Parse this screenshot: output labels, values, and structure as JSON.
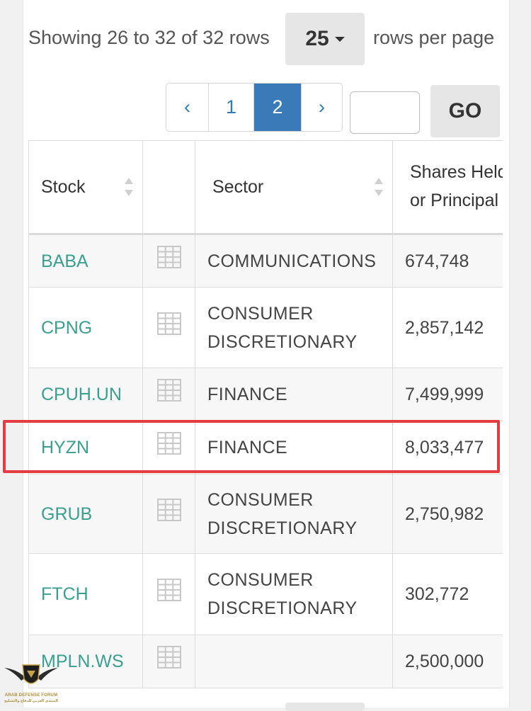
{
  "pagination": {
    "showing_text": "Showing 26 to 32 of 32 rows",
    "page_size": "25",
    "rows_per_page_text": "rows per page",
    "prev_label": "‹",
    "next_label": "›",
    "pages": [
      "1",
      "2"
    ],
    "active_page": "2",
    "goto_value": "",
    "go_label": "GO"
  },
  "table": {
    "headers": {
      "stock": "Stock",
      "sector": "Sector",
      "shares_line1": "Shares Held",
      "shares_line2": "or Principal"
    },
    "rows": [
      {
        "stock": "BABA",
        "sector_line1": "COMMUNICATIONS",
        "sector_line2": "",
        "shares": "674,748"
      },
      {
        "stock": "CPNG",
        "sector_line1": "CONSUMER",
        "sector_line2": "DISCRETIONARY",
        "shares": "2,857,142"
      },
      {
        "stock": "CPUH.UN",
        "sector_line1": "FINANCE",
        "sector_line2": "",
        "shares": "7,499,999"
      },
      {
        "stock": "HYZN",
        "sector_line1": "FINANCE",
        "sector_line2": "",
        "shares": "8,033,477"
      },
      {
        "stock": "GRUB",
        "sector_line1": "CONSUMER",
        "sector_line2": "DISCRETIONARY",
        "shares": "2,750,982"
      },
      {
        "stock": "FTCH",
        "sector_line1": "CONSUMER",
        "sector_line2": "DISCRETIONARY",
        "shares": "302,772"
      },
      {
        "stock": "MPLN.WS",
        "sector_line1": "",
        "sector_line2": "",
        "shares": "2,500,000"
      }
    ],
    "highlighted_stock": "HYZN"
  },
  "watermark": {
    "brand": "ARAB DEFENSE FORUM",
    "tagline": "المنتدى العربي للدفاع والتسليح"
  },
  "colors": {
    "link": "#3a9f8f",
    "active_page": "#3a7ab8",
    "highlight_border": "#e53b43"
  }
}
